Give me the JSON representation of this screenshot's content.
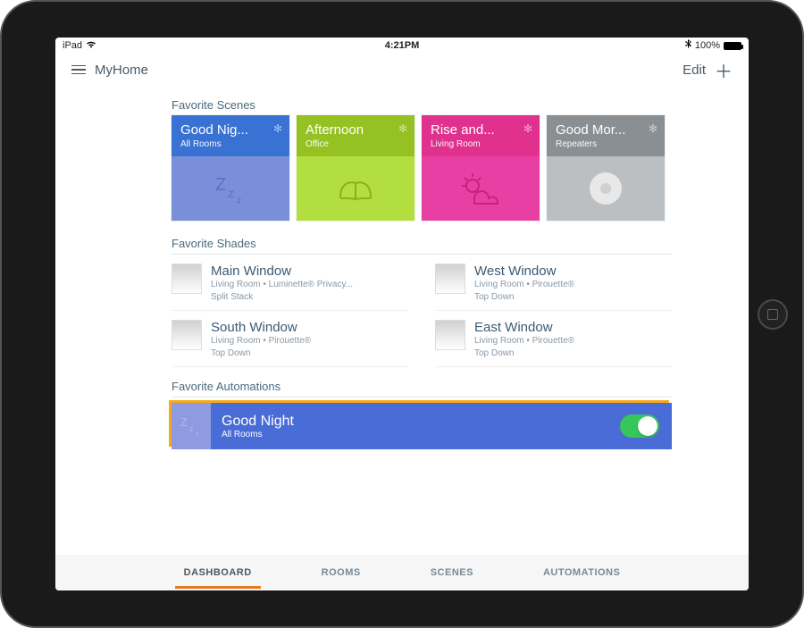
{
  "statusbar": {
    "device": "iPad",
    "time": "4:21PM",
    "battery": "100%"
  },
  "header": {
    "title": "MyHome",
    "edit": "Edit"
  },
  "sections": {
    "scenes": "Favorite Scenes",
    "shades": "Favorite Shades",
    "automations": "Favorite Automations"
  },
  "scenes": [
    {
      "title": "Good Nig...",
      "sub": "All Rooms",
      "color": "blue",
      "icon": "zzz"
    },
    {
      "title": "Afternoon",
      "sub": "Office",
      "color": "green",
      "icon": "book"
    },
    {
      "title": "Rise and...",
      "sub": "Living Room",
      "color": "pink",
      "icon": "sun-cloud"
    },
    {
      "title": "Good Mor...",
      "sub": "Repeaters",
      "color": "grey",
      "icon": "dot"
    }
  ],
  "shades": [
    {
      "name": "Main Window",
      "line1": "Living Room • Luminette® Privacy...",
      "line2": "Split Stack"
    },
    {
      "name": "West Window",
      "line1": "Living Room • Pirouette®",
      "line2": "Top Down"
    },
    {
      "name": "South Window",
      "line1": "Living Room • Pirouette®",
      "line2": "Top Down"
    },
    {
      "name": "East Window",
      "line1": "Living Room • Pirouette®",
      "line2": "Top Down"
    }
  ],
  "automation": {
    "title": "Good Night",
    "sub": "All Rooms",
    "enabled": true
  },
  "tabs": [
    "DASHBOARD",
    "ROOMS",
    "SCENES",
    "AUTOMATIONS"
  ],
  "activeTab": 0
}
